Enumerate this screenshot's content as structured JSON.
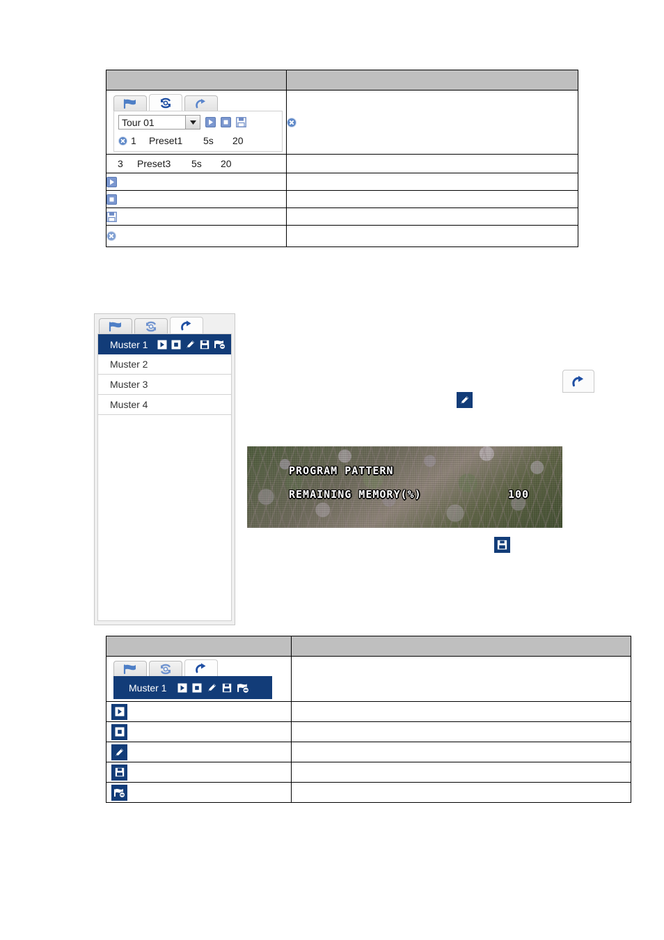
{
  "tour_table": {
    "header": {
      "col1": "",
      "col2": ""
    },
    "widget": {
      "tabs": [
        {
          "name": "preset-tab",
          "icon": "flag-icon",
          "active": false
        },
        {
          "name": "tour-tab",
          "icon": "tour-cycle-icon",
          "active": true
        },
        {
          "name": "pattern-tab",
          "icon": "pattern-arrow-icon",
          "active": false
        }
      ],
      "select": {
        "value": "Tour 01",
        "options": [
          "Tour 01"
        ]
      },
      "buttons": [
        "play-icon",
        "stop-icon",
        "save-icon"
      ],
      "rows": [
        {
          "no": "1",
          "preset": "Preset1",
          "dwell": "5s",
          "speed": "20",
          "deletable": true
        },
        {
          "no": "3",
          "preset": "Preset3",
          "dwell": "5s",
          "speed": "20",
          "deletable": false
        }
      ]
    },
    "rows": [
      {
        "icon": "play-icon",
        "desc": ""
      },
      {
        "icon": "stop-icon",
        "desc": ""
      },
      {
        "icon": "save-icon",
        "desc": ""
      },
      {
        "icon": "delete-icon",
        "desc": ""
      }
    ],
    "right_cell_icon": "delete-icon"
  },
  "pattern_panel": {
    "tabs": [
      {
        "name": "preset-tab",
        "icon": "flag-icon",
        "active": false
      },
      {
        "name": "tour-tab",
        "icon": "tour-cycle-icon",
        "active": false
      },
      {
        "name": "pattern-tab",
        "icon": "pattern-arrow-icon",
        "active": true
      }
    ],
    "items": [
      {
        "label": "Muster 1",
        "selected": true,
        "icons": [
          "play-icon",
          "stop-icon",
          "edit-icon",
          "save-icon",
          "delete-pattern-icon"
        ]
      },
      {
        "label": "Muster 2",
        "selected": false,
        "icons": []
      },
      {
        "label": "Muster 3",
        "selected": false,
        "icons": []
      },
      {
        "label": "Muster 4",
        "selected": false,
        "icons": []
      }
    ]
  },
  "camera": {
    "osd_line1": "PROGRAM PATTERN",
    "osd_line2": "REMAINING MEMORY(%)",
    "osd_value": "100"
  },
  "floating": {
    "pattern_tab_icon": "pattern-arrow-icon",
    "pencil_icon": "edit-icon",
    "save_icon": "save-icon"
  },
  "pattern_table": {
    "header": {
      "col1": "",
      "col2": ""
    },
    "selected_item": {
      "label": "Muster 1",
      "icons": [
        "play-icon",
        "stop-icon",
        "edit-icon",
        "save-icon",
        "delete-pattern-icon"
      ]
    },
    "rows": [
      {
        "icon": "play-icon",
        "desc": ""
      },
      {
        "icon": "stop-icon",
        "desc": ""
      },
      {
        "icon": "edit-icon",
        "desc": ""
      },
      {
        "icon": "save-icon",
        "desc": ""
      },
      {
        "icon": "delete-pattern-icon",
        "desc": ""
      }
    ]
  },
  "colors": {
    "navy": "#123c78",
    "header_gray": "#bfbfbf",
    "icon_blue": "#7b97cf",
    "icon_blue_dark": "#3b6bb5"
  }
}
